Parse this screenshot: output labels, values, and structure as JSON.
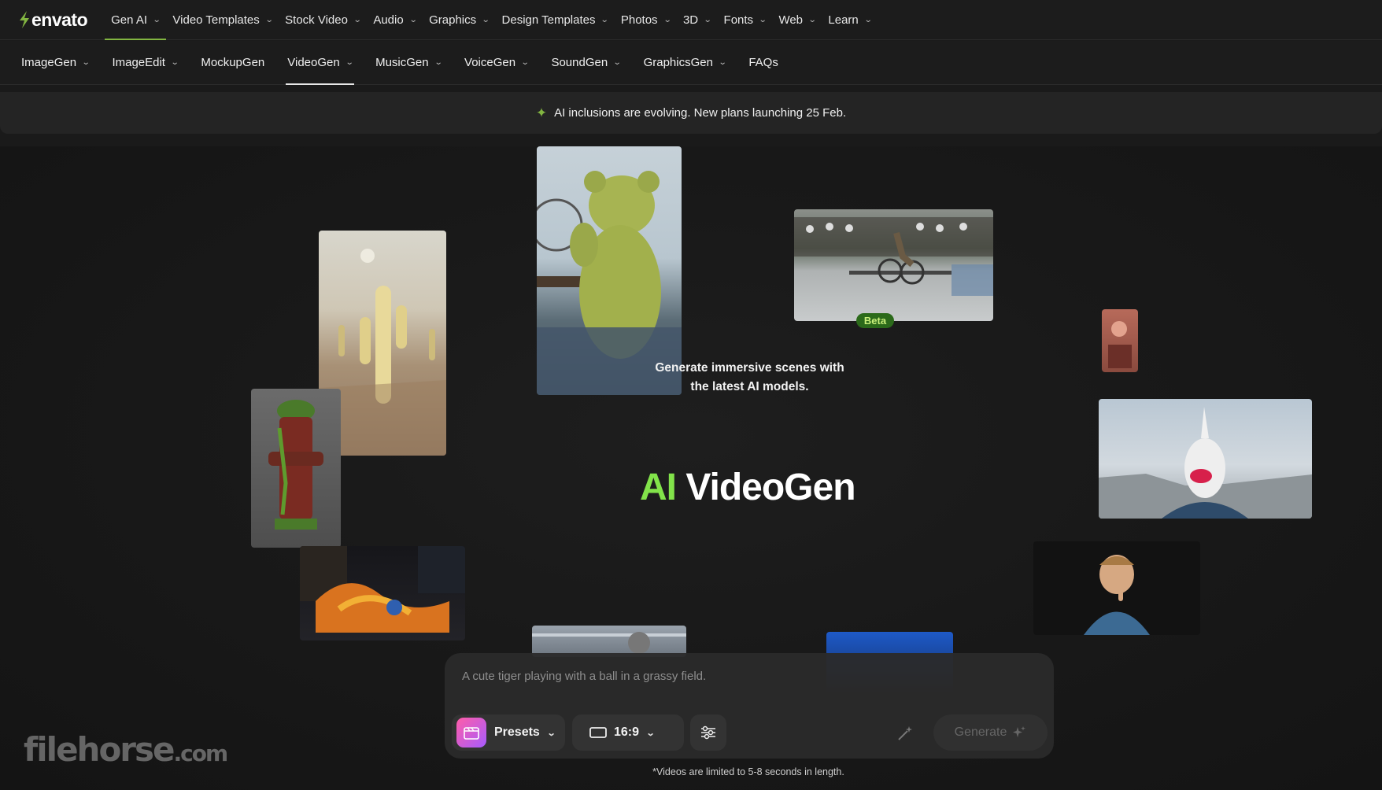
{
  "brand": {
    "name": "envato",
    "accent": "#82b541"
  },
  "topnav": {
    "items": [
      {
        "label": "Gen AI",
        "active": true
      },
      {
        "label": "Video Templates"
      },
      {
        "label": "Stock Video"
      },
      {
        "label": "Audio"
      },
      {
        "label": "Graphics"
      },
      {
        "label": "Design Templates"
      },
      {
        "label": "Photos"
      },
      {
        "label": "3D"
      },
      {
        "label": "Fonts"
      },
      {
        "label": "Web"
      },
      {
        "label": "Learn"
      }
    ]
  },
  "subnav": {
    "items": [
      {
        "label": "ImageGen",
        "dropdown": true
      },
      {
        "label": "ImageEdit",
        "dropdown": true
      },
      {
        "label": "MockupGen",
        "dropdown": false
      },
      {
        "label": "VideoGen",
        "dropdown": true,
        "active": true
      },
      {
        "label": "MusicGen",
        "dropdown": true
      },
      {
        "label": "VoiceGen",
        "dropdown": true
      },
      {
        "label": "SoundGen",
        "dropdown": true
      },
      {
        "label": "GraphicsGen",
        "dropdown": true
      },
      {
        "label": "FAQs",
        "dropdown": false
      }
    ]
  },
  "banner": {
    "text": "AI inclusions are evolving. New plans launching 25 Feb."
  },
  "hero": {
    "title_ai": "AI",
    "title_rest": "VideoGen",
    "badge": "Beta",
    "subtitle": "Generate immersive scenes with the latest AI models."
  },
  "prompt": {
    "placeholder": "A cute tiger playing with a ball in a grassy field.",
    "presets_label": "Presets",
    "ratio_label": "16:9",
    "generate_label": "Generate"
  },
  "footnote": "*Videos are limited to 5-8 seconds in length.",
  "watermark": {
    "main": "filehorse",
    "suffix": ".com"
  }
}
